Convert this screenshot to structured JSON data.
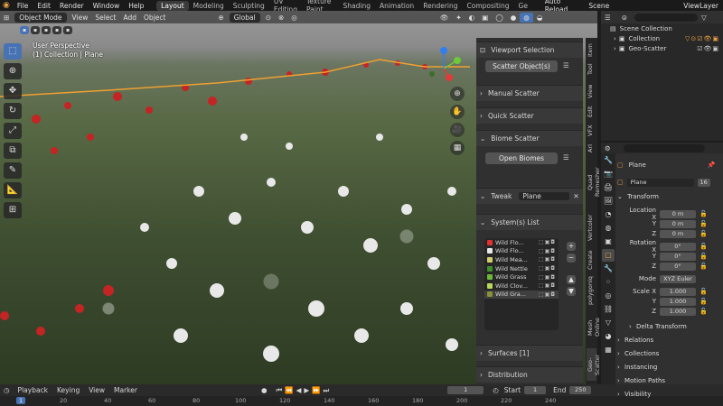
{
  "menubar": {
    "menus": [
      "File",
      "Edit",
      "Render",
      "Window",
      "Help"
    ],
    "workspaces": [
      "Layout",
      "Modeling",
      "Sculpting",
      "UV Editing",
      "Texture Paint",
      "Shading",
      "Animation",
      "Rendering",
      "Compositing",
      "Ge"
    ],
    "active_workspace": "Layout",
    "auto_reload": "Auto Reload",
    "scene": "Scene",
    "view_layer": "ViewLayer"
  },
  "viewport": {
    "mode": "Object Mode",
    "menus": [
      "View",
      "Select",
      "Add",
      "Object"
    ],
    "transform_orientation": "Global",
    "info_line1": "User Perspective",
    "info_line2": "(1) Collection | Plane"
  },
  "scatter_panel": {
    "viewport_selection": "Viewport Selection",
    "scatter_button": "Scatter Object(s)",
    "manual_scatter": "Manual Scatter",
    "quick_scatter": "Quick Scatter",
    "biome_scatter": "Biome Scatter",
    "open_biomes": "Open Biomes",
    "tweak": "Tweak",
    "tweak_object": "Plane",
    "systems_list": "System(s) List",
    "systems": [
      {
        "name": "Wild Flo...",
        "color": "#e03030"
      },
      {
        "name": "Wild Flo...",
        "color": "#e8e8e8"
      },
      {
        "name": "Wild Mea...",
        "color": "#d2d070"
      },
      {
        "name": "Wild Nettle",
        "color": "#3f8f2a"
      },
      {
        "name": "Wild Grass",
        "color": "#6fb83a"
      },
      {
        "name": "Wild Clov...",
        "color": "#b8d860"
      },
      {
        "name": "Wild Gra...",
        "color": "#8a8f3a"
      }
    ],
    "surfaces": "Surfaces [1]",
    "distribution": "Distribution"
  },
  "ntabs": [
    "Item",
    "Tool",
    "View",
    "Edit",
    "VFX",
    "ArI",
    "Quad Remesher",
    "Vertcolor",
    "Create",
    "polygoniq",
    "Mesh Online",
    "Geo-Scatter"
  ],
  "outliner": {
    "scene_collection": "Scene Collection",
    "collection": "Collection",
    "geo_scatter": "Geo-Scatter"
  },
  "properties": {
    "search_placeholder": "",
    "object": "Plane",
    "object_name": "Plane",
    "users": "16",
    "transform": "Transform",
    "location_label": "Location X",
    "location": [
      "0 m",
      "0 m",
      "0 m"
    ],
    "rotation_label": "Rotation X",
    "rotation": [
      "0°",
      "0°",
      "0°"
    ],
    "mode_label": "Mode",
    "mode": "XYZ Euler",
    "scale_label": "Scale X",
    "scale": [
      "1.000",
      "1.000",
      "1.000"
    ],
    "axis_y": "Y",
    "axis_z": "Z",
    "delta_transform": "Delta Transform",
    "relations": "Relations",
    "collections": "Collections",
    "instancing": "Instancing",
    "motion_paths": "Motion Paths",
    "visibility": "Visibility"
  },
  "timeline": {
    "menus": [
      "Playback",
      "Keying",
      "View",
      "Marker"
    ],
    "current_frame": "1",
    "start_label": "Start",
    "start": "1",
    "end_label": "End",
    "end": "250",
    "frame_numbers": [
      "1",
      "20",
      "40",
      "60",
      "80",
      "100",
      "120",
      "140",
      "160",
      "180",
      "200",
      "220",
      "240"
    ]
  },
  "colors": {
    "accent": "#4772b3",
    "panel": "#303030",
    "header": "#1a1a1a"
  }
}
